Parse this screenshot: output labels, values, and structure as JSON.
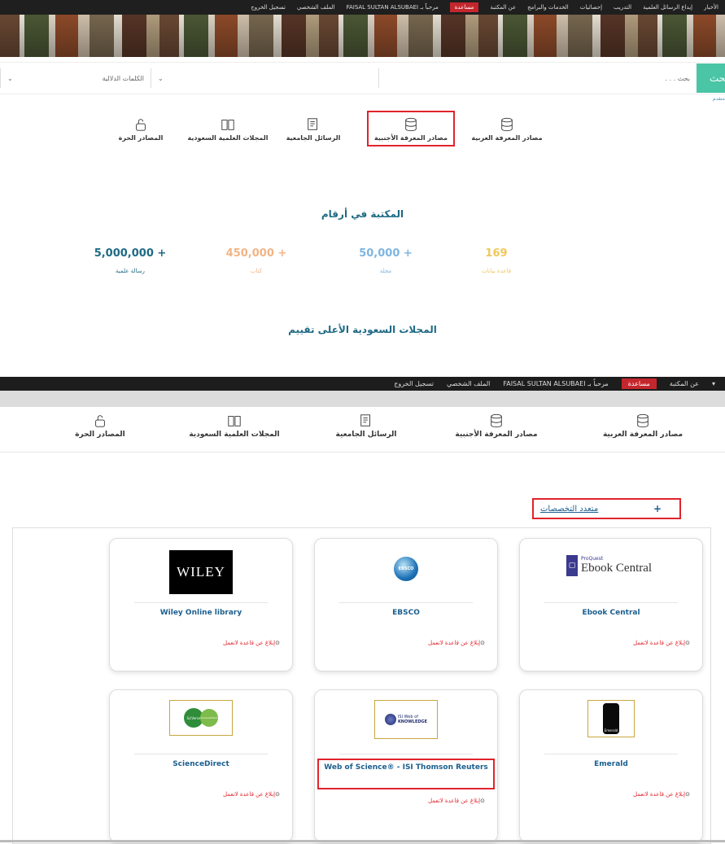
{
  "screenshot1": {
    "topnav": {
      "items": [
        "الأخبار",
        "إيداع الرسائل العلمية",
        "التدريب",
        "إحصائيات",
        "الخدمات والبرامج",
        "عن المكتبة"
      ],
      "help": "مساعدة",
      "welcome": "مرحباً بـ FAISAL SULTAN ALSUBAEI",
      "profile": "الملف الشخصي",
      "logout": "تسجيل الخروج"
    },
    "search": {
      "button": "بحث",
      "query_placeholder": "بحث . . .",
      "keywords_select": "الكلمات الدلالية",
      "advanced": "متقدم"
    },
    "categories": [
      "مصادر المعرفة العربية",
      "مصادر المعرفة الأجنبية",
      "الرسائل الجامعية",
      "المجلات العلمية السعودية",
      "المصادر الحرة"
    ],
    "stats_title": "المكتبة في أرقام",
    "stats": [
      {
        "value": "169",
        "label": "قاعدة بيانات",
        "color": "#f0c75a"
      },
      {
        "value": "50,000 +",
        "label": "مجلة",
        "color": "#7db6e0"
      },
      {
        "value": "450,000 +",
        "label": "كتاب",
        "color": "#f4b484"
      },
      {
        "value": "5,000,000 +",
        "label": "رسالة علمية",
        "color": "#1e6a84"
      }
    ],
    "top_rated_title": "المجلات السعودية الأعلى تقييم"
  },
  "screenshot2": {
    "topnav": {
      "about": "عن المكتبة",
      "help": "مساعدة",
      "welcome": "مرحباً بـ FAISAL SULTAN ALSUBAEI",
      "profile": "الملف الشخصي",
      "logout": "تسجيل الخروج"
    },
    "categories": [
      "مصادر المعرفة العربية",
      "مصادر المعرفة الأجنبية",
      "الرسائل الجامعية",
      "المجلات العلمية السعودية",
      "المصادر الحرة"
    ],
    "section": {
      "plus": "+",
      "title": "متعدد التخصصات"
    },
    "cards": [
      {
        "title": "Ebook Central",
        "logo_text": "Ebook Central",
        "logo_sub": "ProQuest"
      },
      {
        "title": "EBSCO",
        "logo_text": "EBSCO"
      },
      {
        "title": "Wiley Online library",
        "logo_text": "WILEY"
      },
      {
        "title": "Emerald",
        "logo_text": "Emerald"
      },
      {
        "title": "Web of Science® - ISI Thomson Reuters",
        "logo_text": "KNOWLEDGE",
        "logo_sub": "ISI Web of"
      },
      {
        "title": "ScienceDirect",
        "logo_text": "SciVerse",
        "logo_sub": "ScienceDirect"
      }
    ],
    "report_label": "إبلاغ عن قاعدة لاتعمل"
  }
}
